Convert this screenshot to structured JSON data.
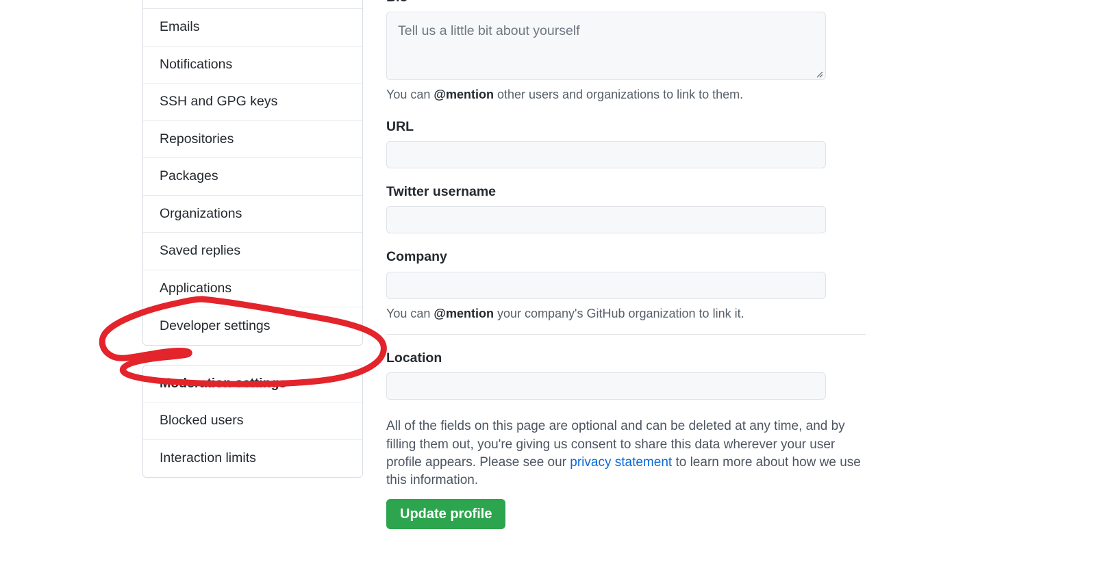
{
  "sidebar": {
    "groups": [
      {
        "name": "personal-settings-group",
        "items": [
          {
            "label": "",
            "blank": true
          },
          {
            "label": "Emails"
          },
          {
            "label": "Notifications"
          },
          {
            "label": "SSH and GPG keys"
          },
          {
            "label": "Repositories"
          },
          {
            "label": "Packages"
          },
          {
            "label": "Organizations"
          },
          {
            "label": "Saved replies"
          },
          {
            "label": "Applications"
          },
          {
            "label": "Developer settings"
          }
        ]
      },
      {
        "name": "moderation-settings-group",
        "items": [
          {
            "label": "Moderation settings",
            "header": true
          },
          {
            "label": "Blocked users"
          },
          {
            "label": "Interaction limits"
          }
        ]
      }
    ]
  },
  "form": {
    "bio": {
      "label": "Bio",
      "placeholder": "Tell us a little bit about yourself",
      "value": "",
      "hint_prefix": "You can ",
      "hint_bold": "@mention",
      "hint_suffix": " other users and organizations to link to them."
    },
    "url": {
      "label": "URL",
      "value": "",
      "placeholder": ""
    },
    "twitter": {
      "label": "Twitter username",
      "value": "",
      "placeholder": ""
    },
    "company": {
      "label": "Company",
      "value": "",
      "placeholder": "",
      "hint_prefix": "You can ",
      "hint_bold": "@mention",
      "hint_suffix": " your company's GitHub organization to link it."
    },
    "location": {
      "label": "Location",
      "value": "",
      "placeholder": ""
    },
    "legal": {
      "text_1": "All of the fields on this page are optional and can be deleted at any time, and by filling them out, you're giving us consent to share this data wherever your user profile appears. Please see our ",
      "link": "privacy statement",
      "text_2": " to learn more about how we use this information."
    },
    "submit_label": "Update profile"
  },
  "annotation": {
    "type": "hand-drawn-circle",
    "target": "Developer settings",
    "color": "#e3242b"
  },
  "colors": {
    "accent_green": "#2da44e",
    "link_blue": "#0969da",
    "annotation_red": "#e3242b",
    "input_bg": "#f6f8fa",
    "border": "#d8dee4"
  }
}
